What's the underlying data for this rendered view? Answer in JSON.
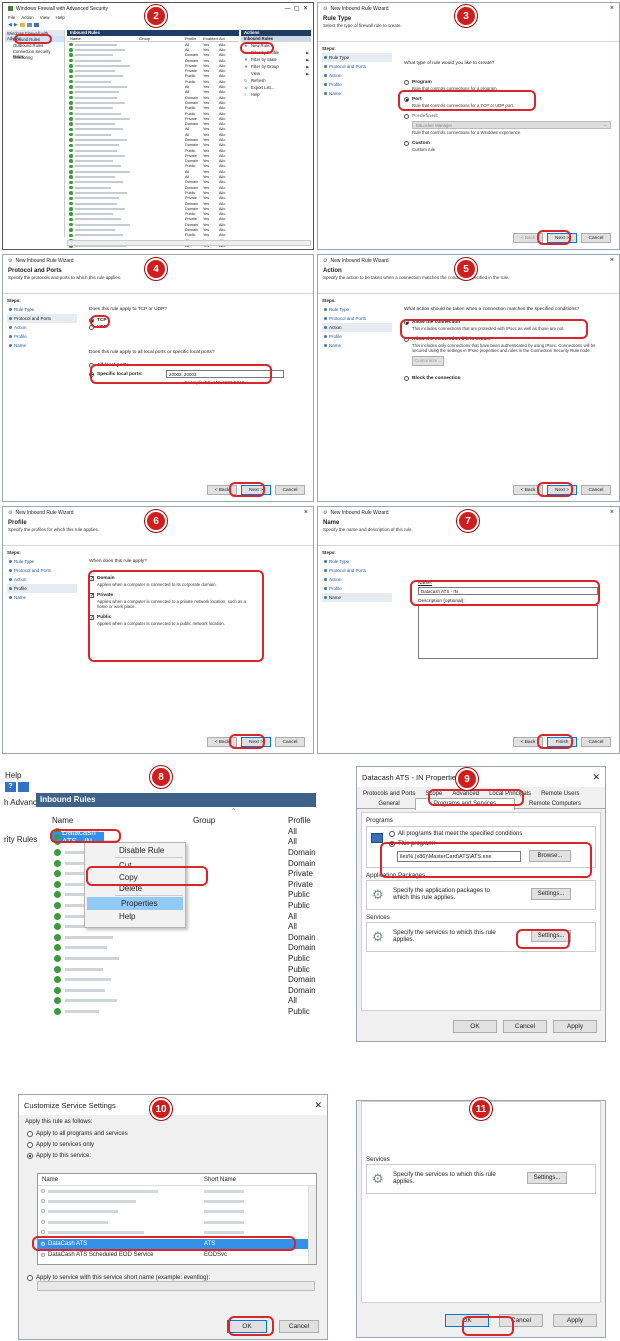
{
  "steps": [
    "2",
    "3",
    "4",
    "5",
    "6",
    "7",
    "8",
    "9",
    "10",
    "11"
  ],
  "p2": {
    "title": "Windows Firewall with Advanced Security",
    "menu": [
      "File",
      "Action",
      "View",
      "Help"
    ],
    "tree": [
      "Windows Firewall with Advanc",
      "Inbound Rules",
      "Outbound Rules",
      "Connection Security Rules",
      "Monitoring"
    ],
    "center_header": "Inbound Rules",
    "cols": [
      "Name",
      "Group",
      "Profile",
      "Enabled",
      "Act"
    ],
    "profiles": [
      "All",
      "All",
      "Domain",
      "Domain",
      "Private",
      "Private",
      "Public",
      "Public",
      "All",
      "All",
      "Domain",
      "Domain",
      "Public",
      "Public",
      "Private",
      "Domain",
      "All",
      "All",
      "Domain",
      "Domain",
      "Public",
      "Private",
      "Domain",
      "Public",
      "All",
      "All",
      "Domain",
      "Domain",
      "Public",
      "Private",
      "Domain",
      "Domain",
      "Public",
      "Private",
      "Domain",
      "Domain",
      "Public",
      "All",
      "All"
    ],
    "enabled": "Yes",
    "act": "Allo",
    "actions_header": "Actions",
    "actions": [
      "Inbound Rules",
      "New Rule...",
      "Filter by Profile",
      "Filter by State",
      "Filter by Group",
      "View",
      "Refresh",
      "Export List...",
      "Help"
    ]
  },
  "wizard": {
    "title": "New Inbound Rule Wizard",
    "steps_title": "Steps:",
    "steps": [
      "Rule Type",
      "Protocol and Ports",
      "Action",
      "Profile",
      "Name"
    ],
    "back": "< Back",
    "next": "Next >",
    "finish": "Finish",
    "cancel": "Cancel"
  },
  "p3": {
    "h1": "Rule Type",
    "h2": "Select the type of firewall rule to create.",
    "question": "What type of rule would you like to create?",
    "options": [
      {
        "label": "Program",
        "desc": "Rule that controls connections for a program."
      },
      {
        "label": "Port",
        "desc": "Rule that controls connections for a TCP or UDP port."
      },
      {
        "label": "Predefined:",
        "desc": "Rule that controls connections for a Windows experience."
      },
      {
        "label": "Custom",
        "desc": "Custom rule"
      }
    ],
    "predefined_value": "BitLocker Manager"
  },
  "p4": {
    "h1": "Protocol and Ports",
    "h2": "Specify the protocols and ports to which this rule applies.",
    "q1": "Does this rule apply to TCP or UDP?",
    "tcp": "TCP",
    "udp": "UDP",
    "q2": "Does this rule apply to all local ports or specific local ports?",
    "all_ports": "All local ports",
    "specific": "Specific local ports:",
    "ports_value": "20002, 20003",
    "example": "Example: 80, 443, 5000-5010"
  },
  "p5": {
    "h1": "Action",
    "h2": "Specify the action to be taken when a connection matches the conditions specified in the rule.",
    "question": "What action should be taken when a connection matches the specified conditions?",
    "allow": "Allow the connection",
    "allow_desc": "This includes connections that are protected with IPsec as well as those are not.",
    "secure": "Allow the connection if it is secure",
    "secure_desc": "This includes only connections that have been authenticated by using IPsec. Connections will be secured using the settings in IPsec properties and rules in the Connection Security Rule node.",
    "customize": "Customize...",
    "block": "Block the connection"
  },
  "p6": {
    "h1": "Profile",
    "h2": "Specify the profiles for which this rule applies.",
    "question": "When does this rule apply?",
    "domain": "Domain",
    "domain_desc": "Applies when a computer is connected to its corporate domain.",
    "private": "Private",
    "private_desc": "Applies when a computer is connected to a private network location, such as a home or work place.",
    "public": "Public",
    "public_desc": "Applies when a computer is connected to a public network location."
  },
  "p7": {
    "h1": "Name",
    "h2": "Specify the name and description of this rule.",
    "name_label": "Name:",
    "name_value": "Datacash ATS - IN",
    "desc_label": "Description (optional):"
  },
  "p8": {
    "menu": "Help",
    "left_top": "h Advance",
    "left_item": "rity Rules",
    "header": "Inbound Rules",
    "col_name": "Name",
    "col_group": "Group",
    "col_profile": "Profile",
    "selected": "Datacash ATS - IN",
    "profiles": [
      "All",
      "All",
      "Domain",
      "Domain",
      "Private",
      "Private",
      "Public",
      "Public",
      "All",
      "All",
      "Domain",
      "Domain",
      "Public",
      "Public",
      "Domain",
      "Domain",
      "All",
      "Public"
    ],
    "context": [
      "Disable Rule",
      "Cut",
      "Copy",
      "Delete",
      "Properties",
      "Help"
    ]
  },
  "p9": {
    "title": "Datacash ATS - IN Properties",
    "tabs_row1": [
      "Protocols and Ports",
      "Scope",
      "Advanced",
      "Local Principals",
      "Remote Users"
    ],
    "tabs_row2": [
      "General",
      "Programs and Services",
      "Remote Computers"
    ],
    "programs_label": "Programs",
    "all_programs": "All programs that meet the specified conditions",
    "this_program": "This program:",
    "program_path": "iles% (x86)\\MasterCard\\ATS\\ATS.exe",
    "browse": "Browse...",
    "app_packages": "Application Packages",
    "app_desc": "Specify the application packages to which this rule applies.",
    "settings": "Settings...",
    "services": "Services",
    "svc_desc": "Specify the services to which this rule applies.",
    "ok": "OK",
    "cancel": "Cancel",
    "apply": "Apply"
  },
  "p10": {
    "title": "Customize Service Settings",
    "apply_label": "Apply this rule as follows:",
    "opt_all": "Apply to all programs and services",
    "opt_services": "Apply to services only",
    "opt_this": "Apply to this service:",
    "col_name": "Name",
    "col_short": "Short Name",
    "selected_name": "DataCash ATS",
    "selected_short": "ATS",
    "next_name": "DataCash ATS Scheduled EOD Service",
    "next_short": "EODSvc",
    "opt_short": "Apply to service with this service short name (example: eventlog):",
    "ok": "OK",
    "cancel": "Cancel"
  },
  "p11": {
    "services": "Services",
    "svc_desc": "Specify the services to which this rule applies.",
    "settings": "Settings...",
    "ok": "OK",
    "cancel": "Cancel",
    "apply": "Apply"
  }
}
